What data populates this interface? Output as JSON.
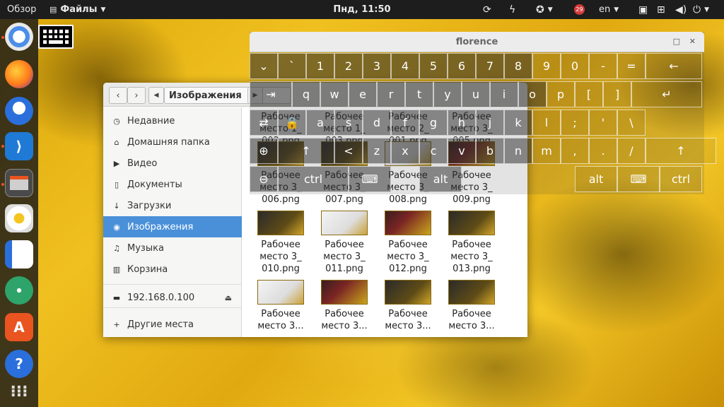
{
  "topbar": {
    "activities": "Обзор",
    "app_menu": "Файлы",
    "clock": "Пнд, 11:50",
    "calendar_badge": "29",
    "language": "en"
  },
  "dock": {
    "items": [
      "chromium",
      "firefox",
      "thunderbird",
      "vscode",
      "files",
      "rhythmbox",
      "writer",
      "atom",
      "software",
      "help",
      "show-apps"
    ]
  },
  "florence": {
    "title": "florence",
    "rows": [
      [
        "⌄",
        "`",
        "1",
        "2",
        "3",
        "4",
        "5",
        "6",
        "7",
        "8",
        "9",
        "0",
        "-",
        "=",
        "←"
      ],
      [
        "⇥",
        "q",
        "w",
        "e",
        "r",
        "t",
        "y",
        "u",
        "i",
        "o",
        "p",
        "[",
        "]",
        "↵"
      ],
      [
        "⇄",
        "🔒",
        "a",
        "s",
        "d",
        "f",
        "g",
        "h",
        "j",
        "k",
        "l",
        ";",
        "'",
        "\\"
      ],
      [
        "⊕",
        "↑",
        "<",
        "z",
        "x",
        "c",
        "v",
        "b",
        "n",
        "m",
        ",",
        ".",
        "/",
        "↑"
      ],
      [
        "⊖",
        "ctrl",
        "⌨",
        "alt",
        "alt",
        "⌨",
        "ctrl"
      ]
    ]
  },
  "files": {
    "path_label": "Изображения",
    "sidebar": [
      {
        "label": "Недавние",
        "icon": "clock-icon"
      },
      {
        "label": "Домашняя папка",
        "icon": "home-icon"
      },
      {
        "label": "Видео",
        "icon": "video-icon"
      },
      {
        "label": "Документы",
        "icon": "document-icon"
      },
      {
        "label": "Загрузки",
        "icon": "download-icon"
      },
      {
        "label": "Изображения",
        "icon": "camera-icon"
      },
      {
        "label": "Музыка",
        "icon": "music-icon"
      },
      {
        "label": "Корзина",
        "icon": "trash-icon"
      }
    ],
    "network_label": "192.168.0.100",
    "other_places": "Другие места",
    "grid_rows": [
      [
        "Рабочее место 1_ 002.png",
        "Рабочее место 1_ 003.png",
        "Рабочее место 2_ 001.png",
        "Рабочее место 3_ 005.png"
      ],
      [
        "Рабочее место 3_ 006.png",
        "Рабочее место 3_ 007.png",
        "Рабочее место 3_ 008.png",
        "Рабочее место 3_ 009.png"
      ],
      [
        "Рабочее место 3_ 010.png",
        "Рабочее место 3_ 011.png",
        "Рабочее место 3_ 012.png",
        "Рабочее место 3_ 013.png"
      ],
      [
        "Рабочее место 3...",
        "Рабочее место 3...",
        "Рабочее место 3...",
        "Рабочее место 3..."
      ]
    ]
  },
  "colors": {
    "accent": "#4a90d9",
    "topbar": "#1d1d1d",
    "ubuntu_orange": "#e95420"
  }
}
